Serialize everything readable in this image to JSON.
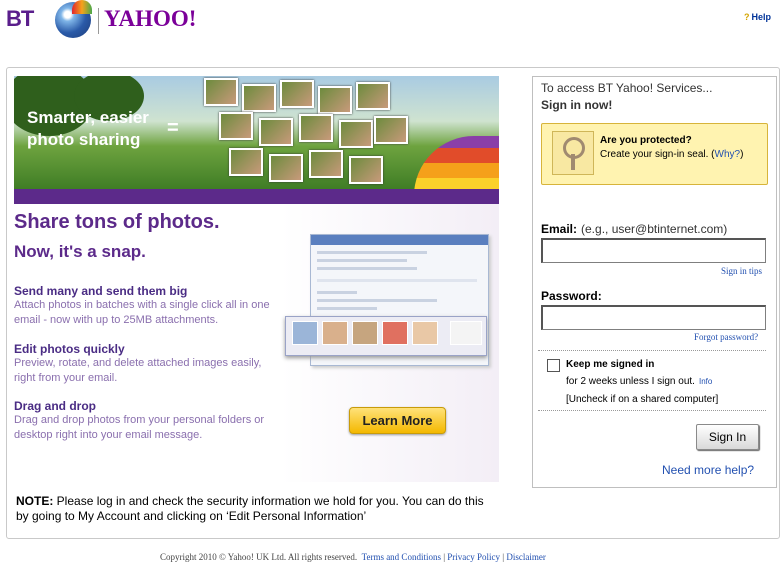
{
  "header": {
    "logo_bt": "BT",
    "logo_yahoo": "YAHOO!",
    "help_label": "Help"
  },
  "promo": {
    "banner_line1": "Smarter, easier",
    "banner_line2": "photo sharing",
    "banner_eq": "=",
    "headline": "Share tons of photos.",
    "subheadline": "Now, it's a snap.",
    "features": [
      {
        "title": "Send many and send them big",
        "desc_1": "Attach photos in batches with a single click all in one",
        "desc_2": "email - now with up to 25MB attachments."
      },
      {
        "title": "Edit photos quickly",
        "desc_1": "Preview, rotate, and delete attached images easily,",
        "desc_2": "right from your email."
      },
      {
        "title": "Drag and drop",
        "desc_1": "Drag and drop photos from your personal folders or",
        "desc_2": "desktop right into your email message."
      }
    ],
    "learn_more": "Learn More"
  },
  "note": {
    "label": "NOTE:",
    "text": " Please log in and check the security information we hold for you. You can do this by going to My Account and clicking on ‘Edit Personal Information’"
  },
  "login": {
    "access_text": "To access BT Yahoo! Services...",
    "signin_now": "Sign in now!",
    "seal_title": "Are you protected?",
    "seal_text": "Create your sign-in seal. (",
    "seal_link": "Why?",
    "seal_close": ")",
    "email_label": "Email:",
    "email_example": "(e.g., user@btinternet.com)",
    "email_value": "",
    "signin_tips": "Sign in tips",
    "password_label": "Password:",
    "password_value": "",
    "forgot_password": "Forgot password?",
    "keep_signed_in": "Keep me signed in",
    "keep_line1": "for 2 weeks unless I sign out.",
    "keep_info": "Info",
    "keep_line2": "[Uncheck if on a shared computer]",
    "signin_button": "Sign In",
    "need_help": "Need more help?"
  },
  "footer": {
    "copyright": "Copyright 2010 © Yahoo! UK Ltd. All rights reserved.",
    "terms": "Terms and Conditions",
    "privacy": "Privacy Policy",
    "disclaimer": "Disclaimer",
    "sep": " | "
  },
  "colors": {
    "brand_purple": "#5c2a8a",
    "link_blue": "#2250b0",
    "button_yellow": "#f4b800"
  }
}
